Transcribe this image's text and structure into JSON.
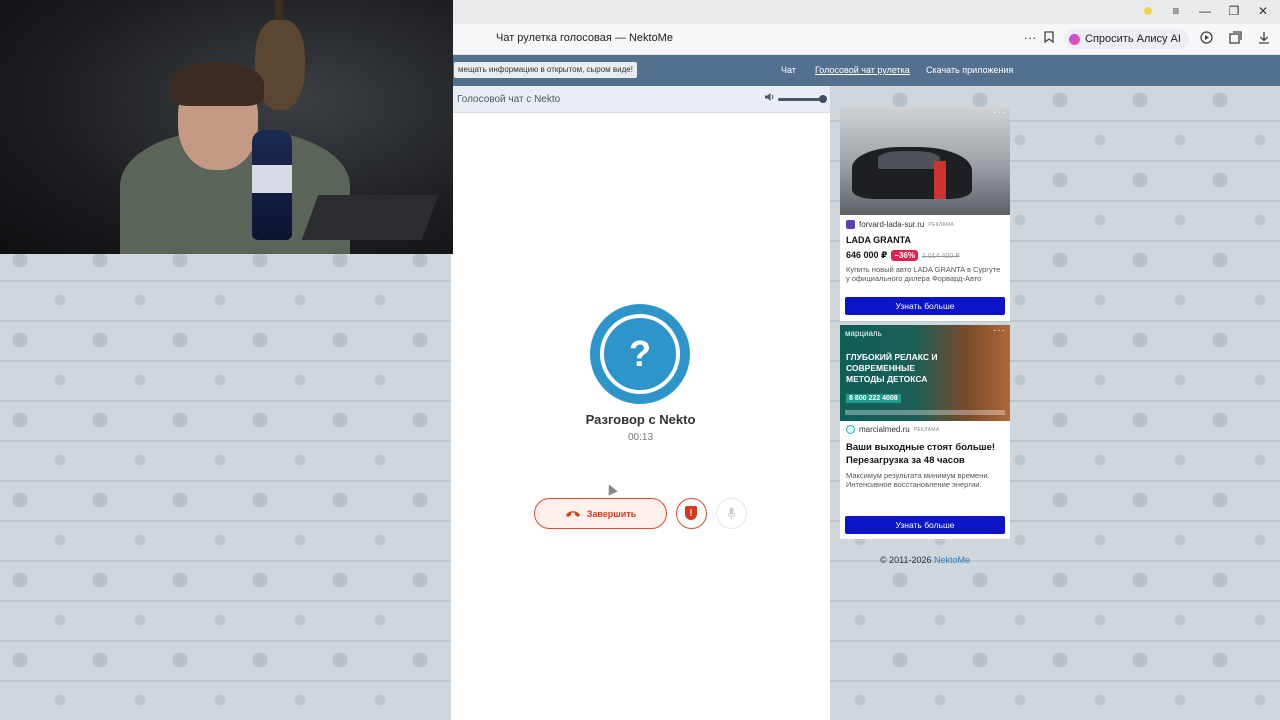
{
  "browser": {
    "tab_title": "Чат рулетка голосовая — NektoMe",
    "alice_label": "Спросить Алису AI",
    "menu_icon": "≡",
    "minimize_icon": "—",
    "restore_icon": "❐",
    "close_icon": "✕",
    "more_icon": "···",
    "bookmark_icon": "bookmark-icon",
    "media_icon": "media-icon",
    "tabs_icon": "tabs-icon",
    "download_icon": "download-icon"
  },
  "site_nav": {
    "notice": "мещать информацию в открытом, сыром виде!",
    "links": [
      "Чат",
      "Голосовой чат рулетка",
      "Скачать приложения"
    ]
  },
  "chat": {
    "panel_title": "Голосовой чат с Nekto",
    "volume": 0.9,
    "avatar_mark": "?",
    "conversation_title": "Разговор с Nekto",
    "timer": "00:13",
    "end_button_label": "Завершить",
    "report_mark": "!",
    "accent_color": "#2d95c9",
    "end_color": "#e1492d"
  },
  "ads": [
    {
      "source": "forvard-lada-sur.ru",
      "reklama": "РЕКЛАМА",
      "title": "LADA GRANTA",
      "price": "646 000 ₽",
      "discount": "−36%",
      "old_price": "1 014 400 ₽",
      "description": "Купить новый авто LADA GRANTA в Сургуте у официального дилера Форвард-Авто",
      "cta": "Узнать больше",
      "menu": "···"
    },
    {
      "logo": "марциаль",
      "image_headline": "ГЛУБОКИЙ РЕЛАКС И СОВРЕМЕННЫЕ МЕТОДЫ ДЕТОКСА",
      "image_phone": "8 800 222 4008",
      "source": "marcialmed.ru",
      "reklama": "РЕКЛАМА",
      "title": "Ваши выходные стоят больше! Перезагрузка за 48 часов",
      "description": "Максимум результата минимум времени. Интенсивное восстановление энергии.",
      "cta": "Узнать больше",
      "menu": "···"
    }
  ],
  "footer": {
    "copyright": "© 2011-2026 ",
    "link": "NektoMe"
  }
}
